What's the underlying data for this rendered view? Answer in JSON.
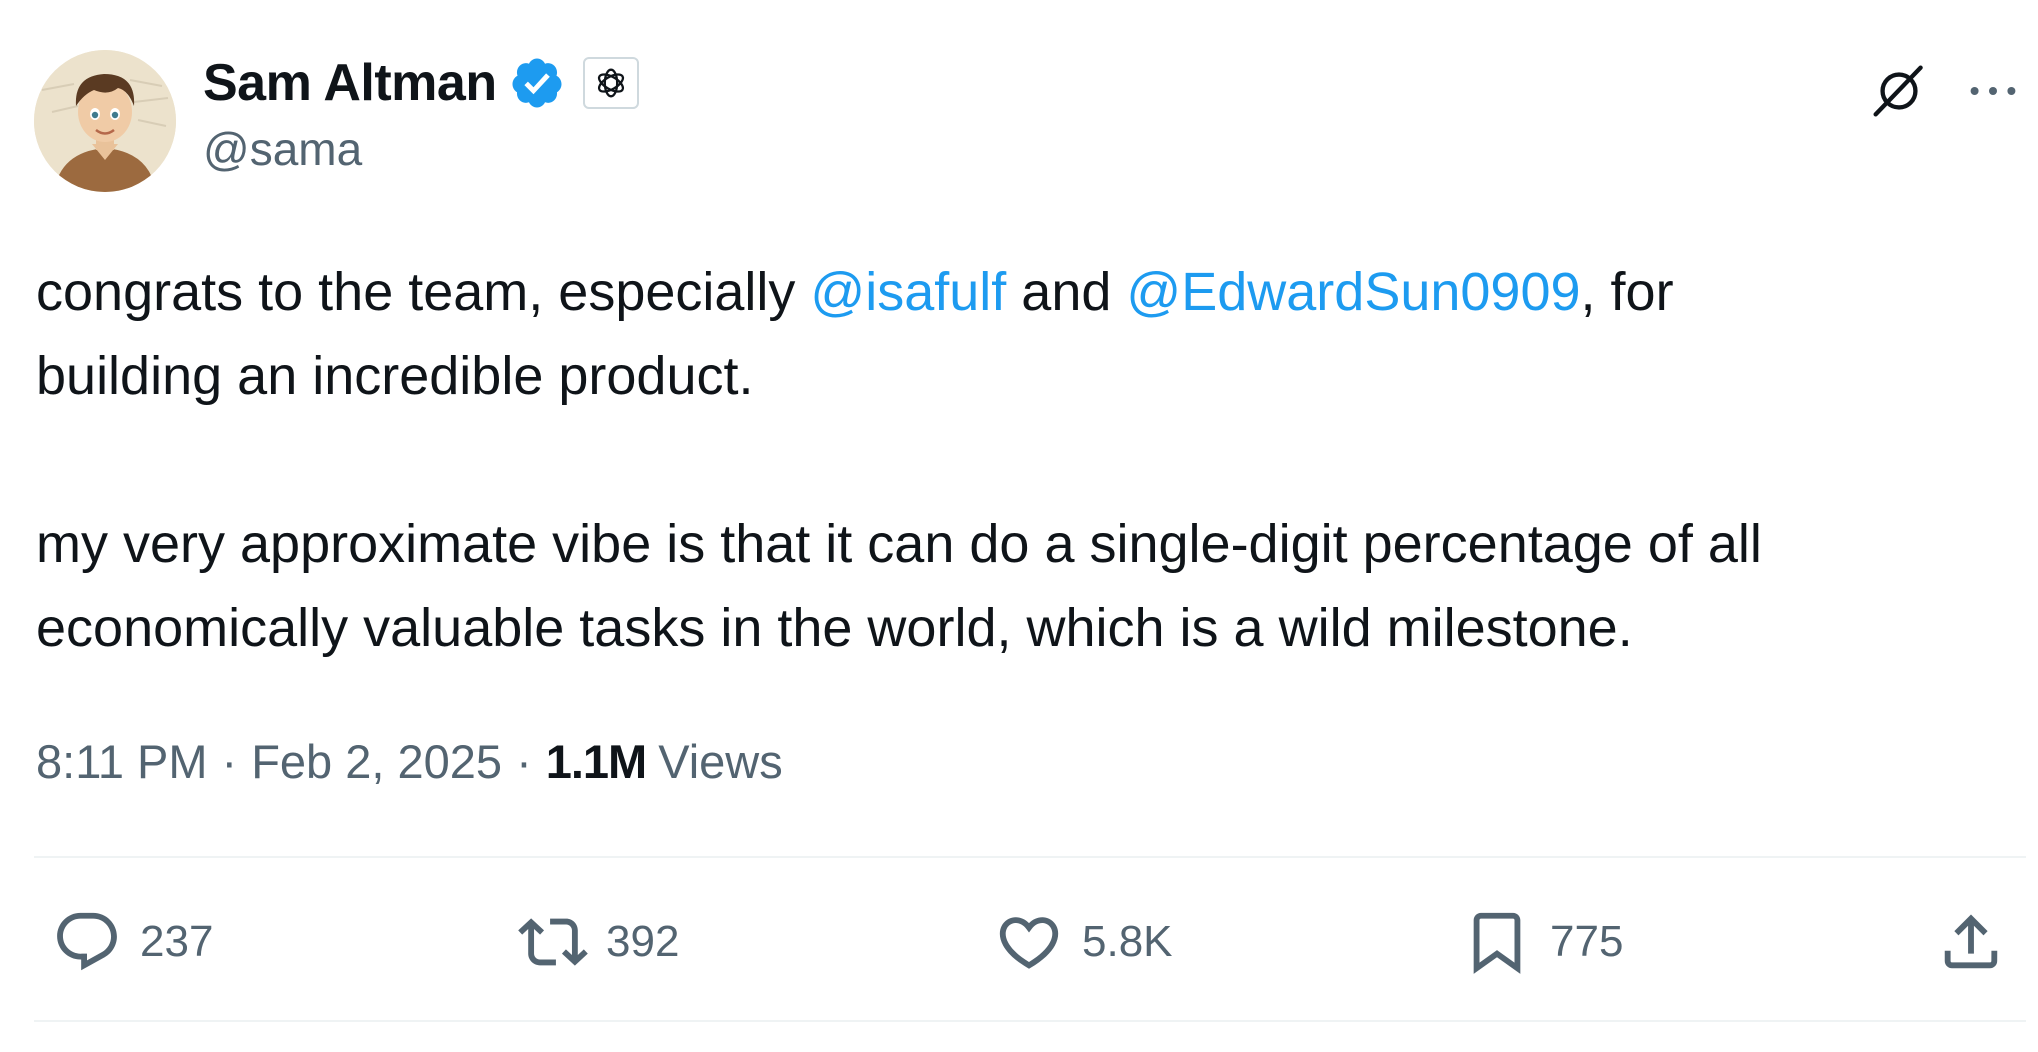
{
  "author": {
    "display_name": "Sam Altman",
    "handle": "@sama",
    "avatar_icon": "cartoon-avatar-icon",
    "verified_icon": "verified-badge-icon",
    "affiliation_icon": "openai-logo-icon"
  },
  "header_actions": {
    "grok_icon": "grok-icon",
    "more_icon": "more-dots-icon"
  },
  "tweet": {
    "line1_pre": "congrats to the team, especially ",
    "mention1": "@isafulf",
    "line1_mid": " and ",
    "mention2": "@EdwardSun0909",
    "line1_post": ", for",
    "line2": "building an incredible product.",
    "line3": "my very approximate vibe is that it can do a single-digit percentage of all",
    "line4": "economically valuable tasks in the world, which is a wild milestone."
  },
  "meta": {
    "time": "8:11 PM",
    "separator": "·",
    "date": "Feb 2, 2025",
    "views_count": "1.1M",
    "views_label": "Views"
  },
  "actions": {
    "replies": "237",
    "retweets": "392",
    "likes": "5.8K",
    "bookmarks": "775"
  },
  "colors": {
    "text": "#0f1419",
    "secondary": "#536471",
    "link": "#1d9bf0",
    "divider": "#eff3f4"
  }
}
